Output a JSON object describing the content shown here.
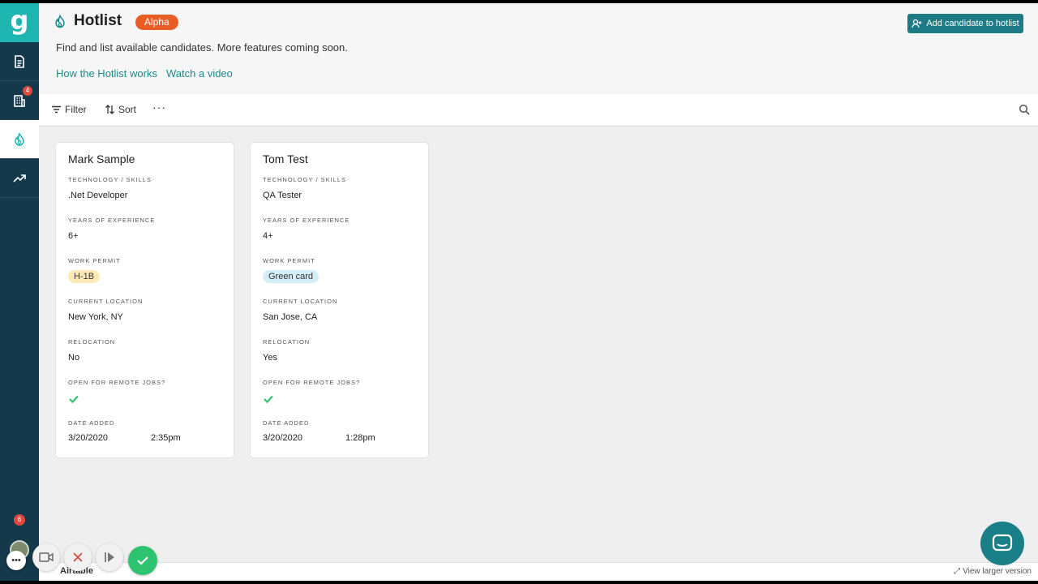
{
  "app": {
    "logo_letter": "g"
  },
  "sidebar": {
    "items": [
      {
        "icon": "document-icon"
      },
      {
        "icon": "building-icon",
        "badge": "4"
      },
      {
        "icon": "flame-icon",
        "active": true
      },
      {
        "icon": "trending-icon"
      }
    ],
    "bottom_badge": "6"
  },
  "header": {
    "title": "Hotlist",
    "badge": "Alpha",
    "subtitle": "Find and list available candidates. More features coming soon.",
    "links": [
      "How the Hotlist works",
      "Watch a video"
    ],
    "add_button": "Add candidate to hotlist"
  },
  "toolbar": {
    "filter": "Filter",
    "sort": "Sort",
    "more": "···"
  },
  "fields": {
    "skills": "TECHNOLOGY / SKILLS",
    "experience": "YEARS OF EXPERIENCE",
    "permit": "WORK PERMIT",
    "location": "CURRENT LOCATION",
    "relocation": "RELOCATION",
    "remote": "OPEN FOR REMOTE JOBS?",
    "date_added": "DATE ADDED"
  },
  "candidates": [
    {
      "name": "Mark Sample",
      "skills": ".Net Developer",
      "experience": "6+",
      "permit": "H-1B",
      "permit_color": "#fde9b5",
      "location": "New York, NY",
      "relocation": "No",
      "remote": true,
      "date": "3/20/2020",
      "time": "2:35pm"
    },
    {
      "name": "Tom Test",
      "skills": "QA Tester",
      "experience": "4+",
      "permit": "Green card",
      "permit_color": "#d3eef6",
      "location": "San Jose, CA",
      "relocation": "Yes",
      "remote": true,
      "date": "3/20/2020",
      "time": "1:28pm"
    }
  ],
  "footer": {
    "brand": "Airtable",
    "view_larger": "View larger version"
  },
  "colors": {
    "accent": "#1b8a8d",
    "sidebar": "#14394b",
    "alpha": "#e85d23",
    "button": "#1e7b86"
  }
}
